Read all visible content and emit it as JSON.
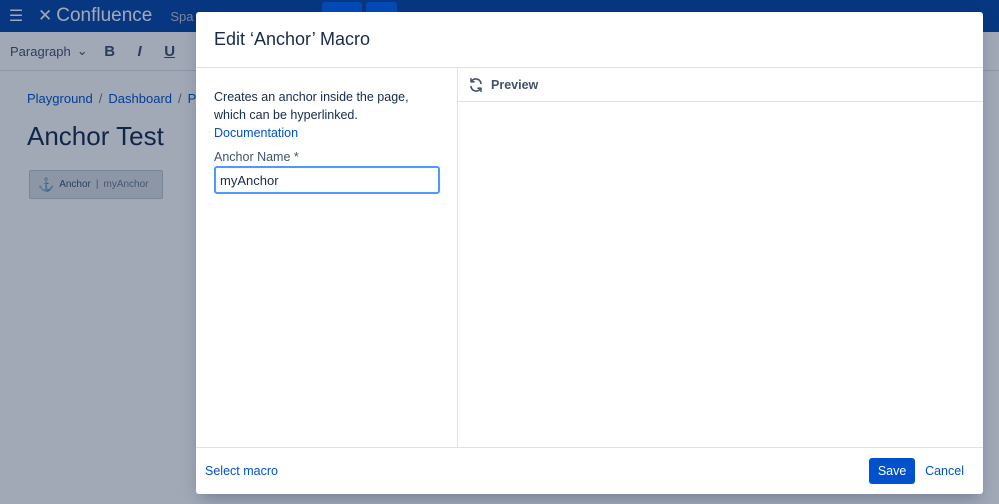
{
  "app": {
    "logo_text": "Confluence",
    "nav_spaces": "Spa"
  },
  "toolbar": {
    "paragraph_label": "Paragraph",
    "bold": "B",
    "italic": "I",
    "underline": "U"
  },
  "page": {
    "breadcrumb": [
      "Playground",
      "Dashboard",
      "Pl"
    ],
    "title": "Anchor Test",
    "macro_placeholder": {
      "label": "Anchor",
      "separator": "|",
      "value": "myAnchor"
    }
  },
  "dialog": {
    "title": "Edit ‘Anchor’ Macro",
    "description": "Creates an anchor inside the page, which can be hyperlinked.",
    "documentation_link": "Documentation",
    "anchor_name_label": "Anchor Name *",
    "anchor_name_value": "myAnchor",
    "preview_label": "Preview",
    "select_macro_link": "Select macro",
    "save_label": "Save",
    "cancel_label": "Cancel"
  },
  "colors": {
    "brand_nav": "#0747a6",
    "link": "#0052cc",
    "primary_button": "#0052cc",
    "focus_border": "#4c9aff"
  }
}
